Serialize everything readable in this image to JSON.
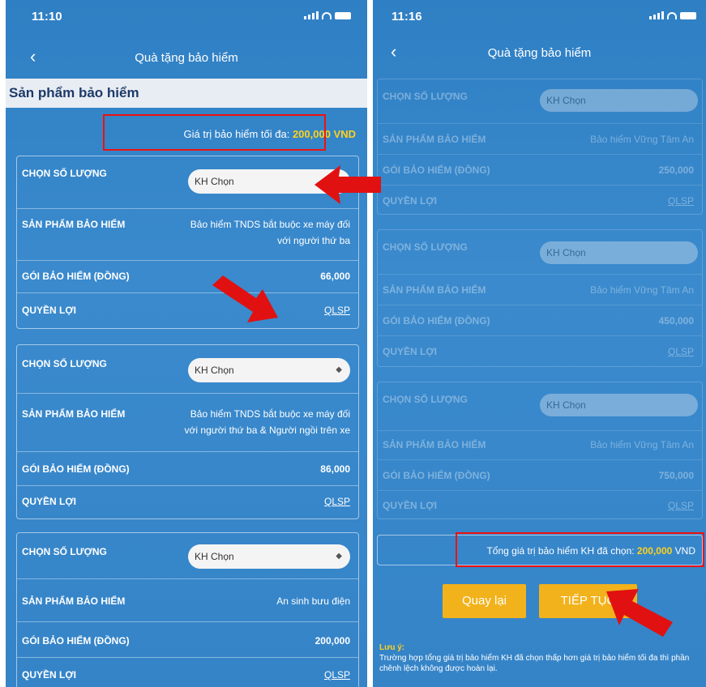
{
  "left": {
    "time": "11:10",
    "nav_title": "Quà tặng bảo hiểm",
    "back": "‹",
    "section_title": "Sản phẩm bảo hiểm",
    "max_label": "Giá trị bảo hiểm tối đa:",
    "max_value": "200,000 VND",
    "cards": [
      {
        "qty_label": "CHỌN SỐ LƯỢNG",
        "select_value": "KH Chọn",
        "product_label": "SẢN PHẨM BẢO HIỂM",
        "product_line1": "Bảo hiểm TNDS bắt buộc xe máy đối",
        "product_line2": "với người thứ ba",
        "package_label": "GÓI BẢO HIỂM (ĐỒNG)",
        "package_value": "66,000",
        "benefit_label": "QUYỀN LỢI",
        "benefit_link": "QLSP"
      },
      {
        "qty_label": "CHỌN SỐ LƯỢNG",
        "select_value": "KH Chọn",
        "product_label": "SẢN PHẨM BẢO HIỂM",
        "product_line1": "Bảo hiểm TNDS bắt buộc xe máy đối",
        "product_line2": "với người thứ ba & Người ngồi trên xe",
        "package_label": "GÓI BẢO HIỂM (ĐỒNG)",
        "package_value": "86,000",
        "benefit_label": "QUYỀN LỢI",
        "benefit_link": "QLSP"
      },
      {
        "qty_label": "CHỌN SỐ LƯỢNG",
        "select_value": "KH Chọn",
        "product_label": "SẢN PHẨM BẢO HIỂM",
        "product_line1": "An sinh bưu điện",
        "product_line2": "",
        "package_label": "GÓI BẢO HIỂM (ĐỒNG)",
        "package_value": "200,000",
        "benefit_label": "QUYỀN LỢI",
        "benefit_link": "QLSP"
      }
    ]
  },
  "right": {
    "time": "11:16",
    "nav_title": "Quà tặng bảo hiểm",
    "back": "‹",
    "cards": [
      {
        "qty_label": "CHỌN SỐ LƯỢNG",
        "select_value": "KH Chọn",
        "product_label": "SẢN PHẨM BẢO HIỂM",
        "product_value": "Bảo hiểm Vững Tâm An",
        "package_label": "GÓI BẢO HIỂM (ĐỒNG)",
        "package_value": "250,000",
        "benefit_label": "QUYỀN LỢI",
        "benefit_link": "QLSP"
      },
      {
        "qty_label": "CHỌN SỐ LƯỢNG",
        "select_value": "KH Chọn",
        "product_label": "SẢN PHẨM BẢO HIỂM",
        "product_value": "Bảo hiểm Vững Tâm An",
        "package_label": "GÓI BẢO HIỂM (ĐỒNG)",
        "package_value": "450,000",
        "benefit_label": "QUYỀN LỢI",
        "benefit_link": "QLSP"
      },
      {
        "qty_label": "CHỌN SỐ LƯỢNG",
        "select_value": "KH Chọn",
        "product_label": "SẢN PHẨM BẢO HIỂM",
        "product_value": "Bảo hiểm Vững Tâm An",
        "package_label": "GÓI BẢO HIỂM (ĐỒNG)",
        "package_value": "750,000",
        "benefit_label": "QUYỀN LỢI",
        "benefit_link": "QLSP"
      }
    ],
    "total_label": "Tổng giá trị bảo hiểm KH đã chọn:",
    "total_value": "200,000",
    "total_unit": "VND",
    "back_button": "Quay lại",
    "continue_button": "TIẾP TỤC",
    "note_title": "Lưu ý:",
    "note_text": "Trường hợp tổng giá trị bảo hiểm KH đã chọn thấp hơn giá trị bảo hiểm tối đa thì phần chênh lệch không được hoàn lại."
  },
  "colors": {
    "accent_yellow": "#ffd21a",
    "button": "#f2b21b",
    "annotation_red": "#e11111",
    "background_blue": "#3584c8"
  }
}
